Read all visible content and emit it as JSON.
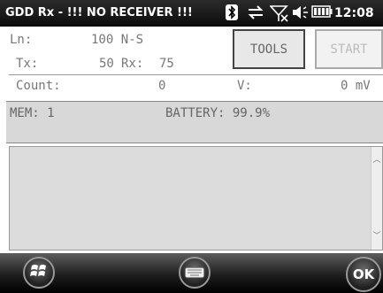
{
  "titlebar": {
    "title": "GDD Rx - !!! NO RECEIVER !!!",
    "time": "12:08"
  },
  "form": {
    "line_label": "Ln:",
    "line_value": "100 N-S",
    "tx_label": "Tx:",
    "tx_value": "50",
    "rx_label": "Rx:",
    "rx_value": "75",
    "count_label": "Count:",
    "count_value": "0",
    "voltage_label": "V:",
    "voltage_value": "0 mV"
  },
  "buttons": {
    "tools": "TOOLS",
    "start": "START"
  },
  "status": {
    "mem": "MEM: 1",
    "battery": "BATTERY: 99.9%"
  },
  "bottombar": {
    "ok": "OK"
  },
  "icons": [
    "bluetooth-icon",
    "sync-icon",
    "signal-icon",
    "volume-icon",
    "battery-icon",
    "windows-start-icon",
    "keyboard-icon"
  ]
}
